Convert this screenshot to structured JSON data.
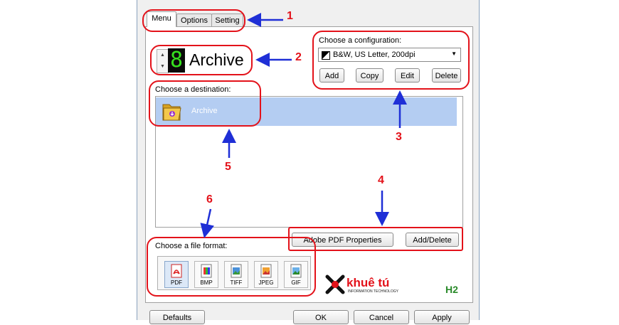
{
  "tabs": [
    "Menu",
    "Options",
    "Setting"
  ],
  "digit": "8",
  "menu_name": "Archive",
  "configuration": {
    "label": "Choose a configuration:",
    "selected": "B&W, US Letter, 200dpi",
    "buttons": [
      "Add",
      "Copy",
      "Edit",
      "Delete"
    ]
  },
  "destination": {
    "label": "Choose a destination:",
    "items": [
      "Archive"
    ]
  },
  "destination_buttons": [
    "Adobe PDF Properties",
    "Add/Delete"
  ],
  "file_format": {
    "label": "Choose a file format:",
    "formats": [
      "PDF",
      "BMP",
      "TIFF",
      "JPEG",
      "GIF"
    ],
    "selected": "PDF"
  },
  "logo": {
    "text": "khuê tú",
    "subtitle": "INFORMATION TECHNOLOGY"
  },
  "corner_label": "H2",
  "bottom_buttons": [
    "Defaults",
    "OK",
    "Cancel",
    "Apply"
  ],
  "annotations": [
    "1",
    "2",
    "3",
    "4",
    "5",
    "6"
  ],
  "colors": {
    "annotation_red": "#e3121a",
    "annotation_blue": "#1f2fd6",
    "selection": "#b4cdf2",
    "digit_green": "#36e01e"
  }
}
